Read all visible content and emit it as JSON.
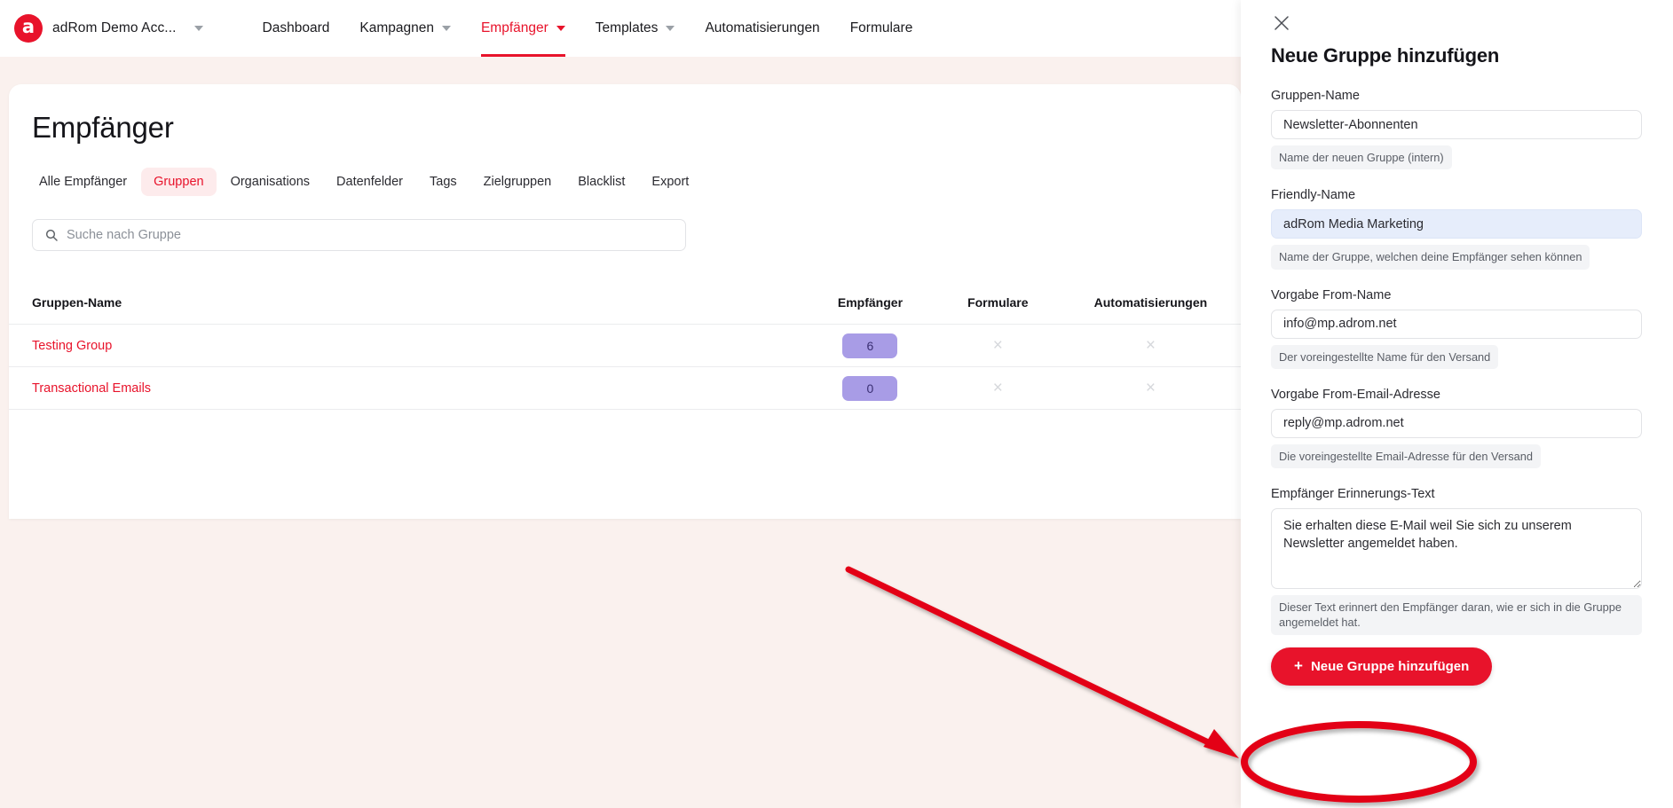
{
  "topbar": {
    "brand": {
      "logo_letter": "a",
      "account_name": "adRom Demo Acc..."
    },
    "nav": [
      {
        "label": "Dashboard",
        "has_caret": false,
        "active": false
      },
      {
        "label": "Kampagnen",
        "has_caret": true,
        "active": false
      },
      {
        "label": "Empfänger",
        "has_caret": true,
        "active": true
      },
      {
        "label": "Templates",
        "has_caret": true,
        "active": false
      },
      {
        "label": "Automatisierungen",
        "has_caret": false,
        "active": false
      },
      {
        "label": "Formulare",
        "has_caret": false,
        "active": false
      }
    ]
  },
  "main": {
    "page_title": "Empfänger",
    "tabs": [
      {
        "label": "Alle Empfänger",
        "active": false
      },
      {
        "label": "Gruppen",
        "active": true
      },
      {
        "label": "Organisations",
        "active": false
      },
      {
        "label": "Datenfelder",
        "active": false
      },
      {
        "label": "Tags",
        "active": false
      },
      {
        "label": "Zielgruppen",
        "active": false
      },
      {
        "label": "Blacklist",
        "active": false
      },
      {
        "label": "Export",
        "active": false
      }
    ],
    "search": {
      "value": "",
      "placeholder": "Suche nach Gruppe"
    },
    "table": {
      "headers": [
        "Gruppen-Name",
        "Empfänger",
        "Formulare",
        "Automatisierungen"
      ],
      "rows": [
        {
          "name": "Testing Group",
          "empfaenger": "6",
          "formulare": "×",
          "automatisierungen": "×"
        },
        {
          "name": "Transactional Emails",
          "empfaenger": "0",
          "formulare": "×",
          "automatisierungen": "×"
        }
      ]
    }
  },
  "drawer": {
    "close_icon": "close-icon",
    "title": "Neue Gruppe hinzufügen",
    "fields": [
      {
        "label": "Gruppen-Name",
        "value": "Newsletter-Abonnenten",
        "hint": "Name der neuen Gruppe (intern)",
        "type": "text",
        "highlight": false
      },
      {
        "label": "Friendly-Name",
        "value": "adRom Media Marketing",
        "hint": "Name der Gruppe, welchen deine Empfänger sehen können",
        "type": "text",
        "highlight": true
      },
      {
        "label": "Vorgabe From-Name",
        "value": "info@mp.adrom.net",
        "hint": "Der voreingestellte Name für den Versand",
        "type": "text",
        "highlight": false
      },
      {
        "label": "Vorgabe From-Email-Adresse",
        "value": "reply@mp.adrom.net",
        "hint": "Die voreingestellte Email-Adresse für den Versand",
        "type": "text",
        "highlight": false
      },
      {
        "label": "Empfänger Erinnerungs-Text",
        "value": "Sie erhalten diese E-Mail weil Sie sich zu unserem Newsletter angemeldet haben.",
        "hint": "Dieser Text erinnert den Empfänger daran, wie er sich in die Gruppe angemeldet hat.",
        "type": "textarea",
        "highlight": false
      }
    ],
    "submit": {
      "plus": "+",
      "label": "Neue Gruppe hinzufügen"
    }
  },
  "annotation": {
    "arrow_color": "#e30613",
    "highlight_shape": "ellipse"
  },
  "colors": {
    "accent_red": "#e8132b",
    "page_background": "#faf1ee",
    "chip_purple": "#a89ce6",
    "field_highlight_blue": "#e6edfb"
  }
}
